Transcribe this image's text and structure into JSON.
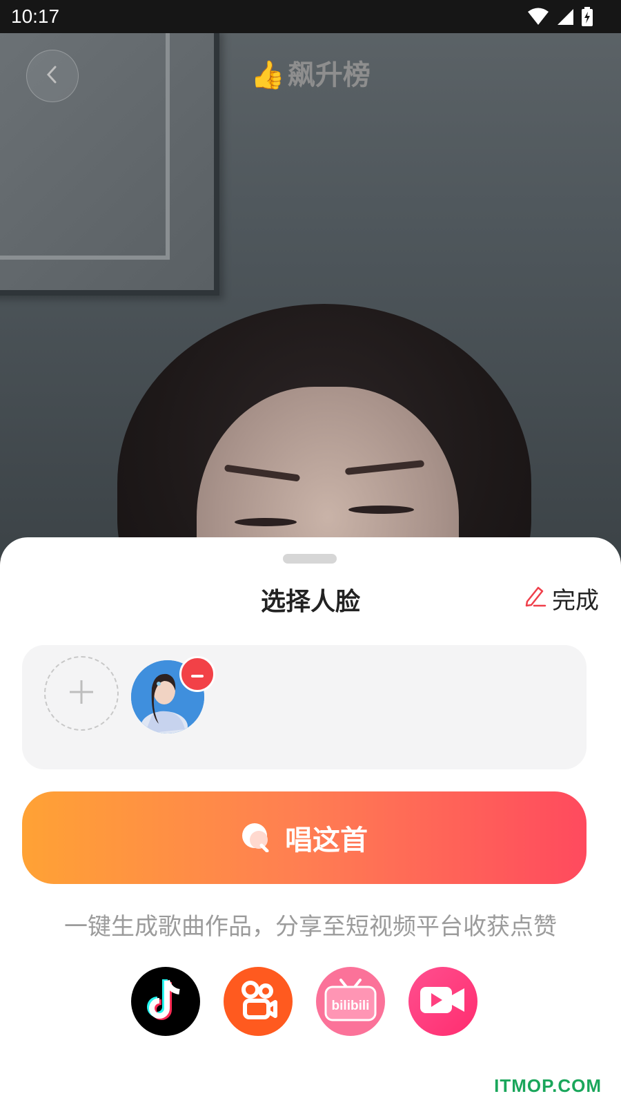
{
  "status_bar": {
    "time": "10:17"
  },
  "header": {
    "title_emoji": "👍",
    "title": "飙升榜"
  },
  "sheet": {
    "title": "选择人脸",
    "done_label": "完成",
    "sing_label": "唱这首",
    "hint": "一键生成歌曲作品，分享至短视频平台收获点赞"
  },
  "platforms": [
    {
      "name": "douyin-icon"
    },
    {
      "name": "kuaishou-icon"
    },
    {
      "name": "bilibili-icon",
      "label": "bilibili"
    },
    {
      "name": "video-icon"
    }
  ],
  "colors": {
    "accent_start": "#ffa235",
    "accent_end": "#ff4a5e",
    "remove_red": "#f24147",
    "watermark_green": "#1aa65b"
  },
  "watermark": "ITMOP.COM"
}
